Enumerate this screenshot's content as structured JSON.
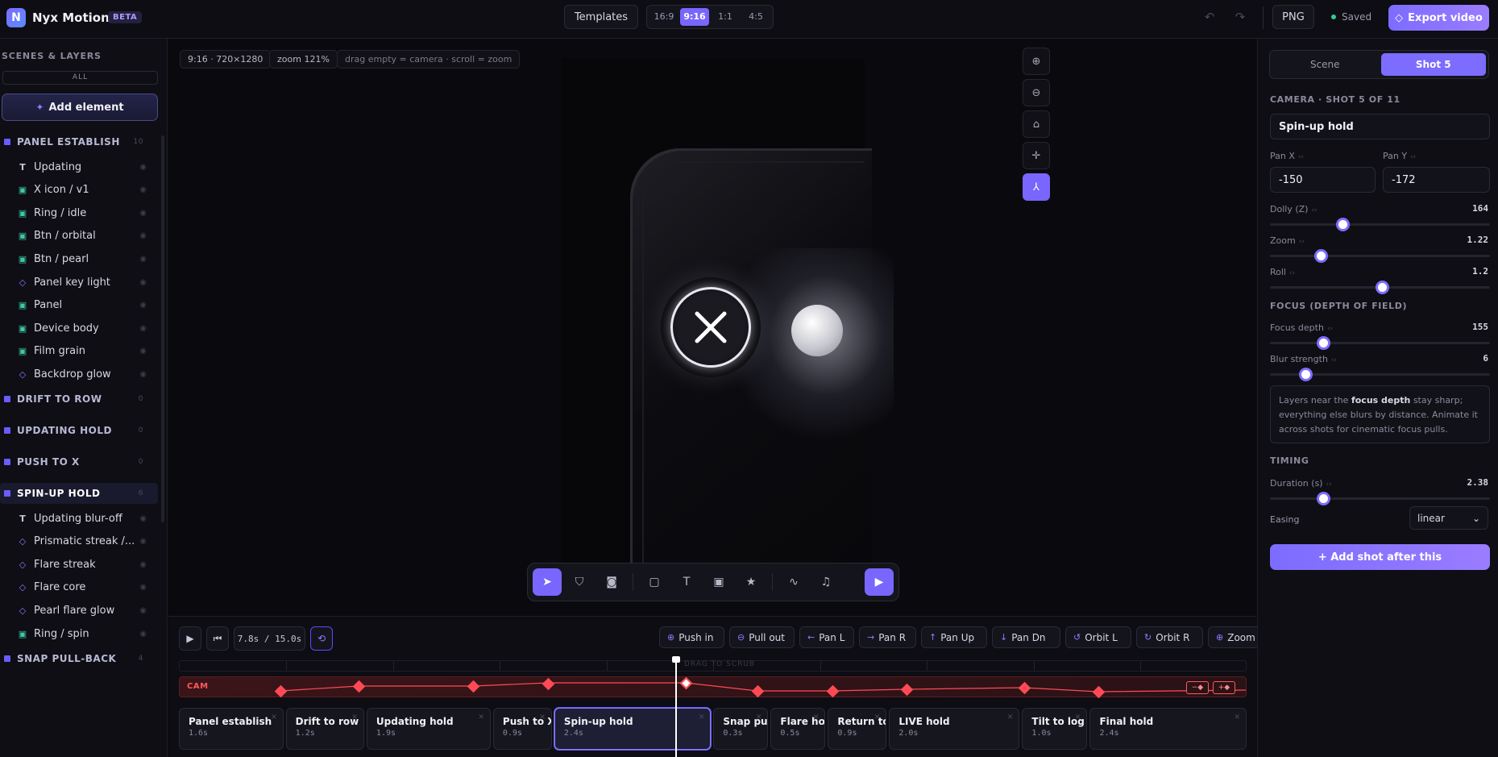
{
  "app": {
    "logo_letter": "N",
    "name": "Nyx Motion",
    "badge": "BETA"
  },
  "topbar": {
    "templates_label": "Templates",
    "aspect_ratios": [
      "16:9",
      "9:16",
      "1:1",
      "4:5"
    ],
    "active_aspect": "9:16",
    "format_label": "PNG",
    "save_status": "Saved",
    "export_label": "Export video"
  },
  "sidebar": {
    "title": "SCENES & LAYERS",
    "filter_all": "ALL",
    "add_element": "Add element",
    "groups": [
      {
        "name": "PANEL ESTABLISH",
        "count": "10",
        "layers": [
          {
            "icon": "text",
            "label": "Updating"
          },
          {
            "icon": "image",
            "label": "X icon / v1"
          },
          {
            "icon": "image",
            "label": "Ring / idle"
          },
          {
            "icon": "image",
            "label": "Btn / orbital"
          },
          {
            "icon": "image",
            "label": "Btn / pearl"
          },
          {
            "icon": "diamond",
            "label": "Panel key light"
          },
          {
            "icon": "image",
            "label": "Panel"
          },
          {
            "icon": "image",
            "label": "Device body"
          },
          {
            "icon": "image",
            "label": "Film grain"
          },
          {
            "icon": "diamond",
            "label": "Backdrop glow"
          }
        ]
      },
      {
        "name": "DRIFT TO ROW",
        "count": "0",
        "layers": []
      },
      {
        "name": "UPDATING HOLD",
        "count": "0",
        "layers": []
      },
      {
        "name": "PUSH TO X",
        "count": "0",
        "layers": []
      },
      {
        "name": "SPIN-UP HOLD",
        "count": "6",
        "selected": true,
        "layers": [
          {
            "icon": "text",
            "label": "Updating blur-off"
          },
          {
            "icon": "diamond",
            "label": "Prismatic streak /..."
          },
          {
            "icon": "diamond",
            "label": "Flare streak"
          },
          {
            "icon": "diamond",
            "label": "Flare core"
          },
          {
            "icon": "diamond",
            "label": "Pearl flare glow"
          },
          {
            "icon": "image",
            "label": "Ring / spin"
          }
        ]
      },
      {
        "name": "SNAP PULL-BACK",
        "count": "4",
        "layers": []
      }
    ]
  },
  "stage": {
    "format_chip": "9:16 · 720×1280",
    "zoom_chip": "zoom 121%",
    "hint_chip": "drag empty = camera · scroll = zoom"
  },
  "timeline": {
    "time_readout": "7.8s / 15.0s",
    "scrub_hint": "DRAG TO SCRUB",
    "cam_label": "CAM",
    "camera_moves": [
      "Push in",
      "Pull out",
      "Pan L",
      "Pan R",
      "Pan Up",
      "Pan Dn",
      "Orbit L",
      "Orbit R",
      "Zoom"
    ],
    "playhead_time_s": 7.8,
    "total_time_s": 15.0,
    "shots": [
      {
        "name": "Panel establish",
        "duration": "1.6s"
      },
      {
        "name": "Drift to row",
        "duration": "1.2s"
      },
      {
        "name": "Updating hold",
        "duration": "1.9s"
      },
      {
        "name": "Push to X",
        "duration": "0.9s"
      },
      {
        "name": "Spin-up hold",
        "duration": "2.4s",
        "selected": true
      },
      {
        "name": "Snap pull",
        "duration": "0.3s"
      },
      {
        "name": "Flare hold",
        "duration": "0.5s"
      },
      {
        "name": "Return to X",
        "duration": "0.9s"
      },
      {
        "name": "LIVE hold",
        "duration": "2.0s"
      },
      {
        "name": "Tilt to log",
        "duration": "1.0s"
      },
      {
        "name": "Final hold",
        "duration": "2.4s"
      }
    ]
  },
  "inspector": {
    "tabs": [
      "Scene",
      "Shot 5"
    ],
    "active_tab": "Shot 5",
    "camera_heading": "CAMERA · SHOT 5 OF 11",
    "shot_name": "Spin-up hold",
    "pan_x_label": "Pan X",
    "pan_y_label": "Pan Y",
    "pan_x": "-150",
    "pan_y": "-172",
    "dolly": {
      "label": "Dolly (Z)",
      "value": "164",
      "fraction": 0.33
    },
    "zoom": {
      "label": "Zoom",
      "value": "1.22",
      "fraction": 0.23
    },
    "roll": {
      "label": "Roll",
      "value": "1.2",
      "fraction": 0.51
    },
    "focus_heading": "FOCUS (DEPTH OF FIELD)",
    "focus_depth": {
      "label": "Focus depth",
      "value": "155",
      "fraction": 0.24
    },
    "blur_strength": {
      "label": "Blur strength",
      "value": "6",
      "fraction": 0.16
    },
    "note_pre": "Layers near the ",
    "note_bold": "focus depth",
    "note_post": " stay sharp; everything else blurs by distance. Animate it across shots for cinematic focus pulls.",
    "timing_heading": "TIMING",
    "duration": {
      "label": "Duration (s)",
      "value": "2.38",
      "fraction": 0.24
    },
    "easing_label": "Easing",
    "easing_value": "linear",
    "add_shot": "+ Add shot after this"
  }
}
